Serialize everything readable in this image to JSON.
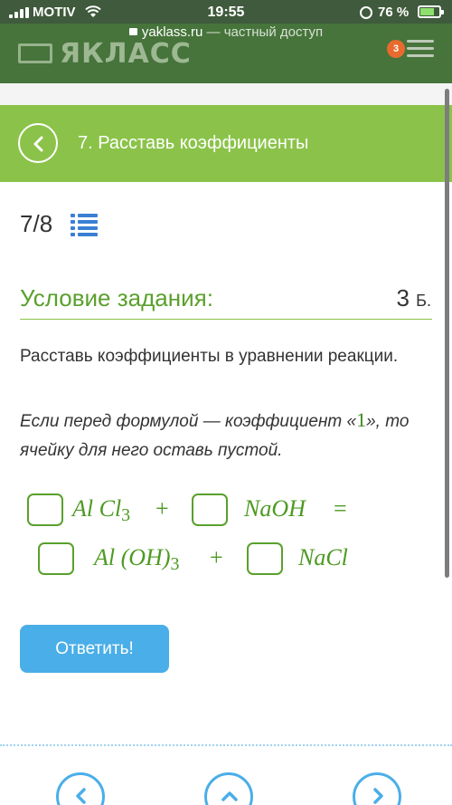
{
  "status_bar": {
    "carrier": "MOTIV",
    "time": "19:55",
    "battery": "76 %"
  },
  "browser": {
    "domain": "yaklass.ru",
    "suffix": " — частный доступ"
  },
  "site": {
    "logo_text": "ЯКЛАСС",
    "badge_count": "3"
  },
  "task_header": {
    "title": "7. Расставь коэффициенты"
  },
  "progress": {
    "current": "7",
    "separator": "/",
    "total": "8"
  },
  "condition": {
    "title": "Условие задания:",
    "points_value": "3",
    "points_unit": "Б."
  },
  "task": {
    "text": "Расставь коэффициенты в уравнении реакции.",
    "note_prefix": "Если перед формулой — коэффициент «",
    "note_one": "1",
    "note_suffix": "», то ячейку для него оставь пустой."
  },
  "equation": {
    "reactant1": "Al Cl",
    "reactant1_sub": "3",
    "plus1": "+",
    "reactant2": "NaOH",
    "equals": "=",
    "product1": "Al (OH)",
    "product1_sub": "3",
    "plus2": "+",
    "product2": "NaCl",
    "coefficients": [
      "",
      "",
      "",
      ""
    ]
  },
  "answer_button": {
    "label": "Ответить!"
  },
  "colors": {
    "brand_green": "#8bc34a",
    "formula_green": "#4d9a22",
    "button_blue": "#4aaee8"
  },
  "icons": [
    "back-arrow-icon",
    "task-list-icon",
    "prev-icon",
    "up-icon",
    "next-icon"
  ]
}
